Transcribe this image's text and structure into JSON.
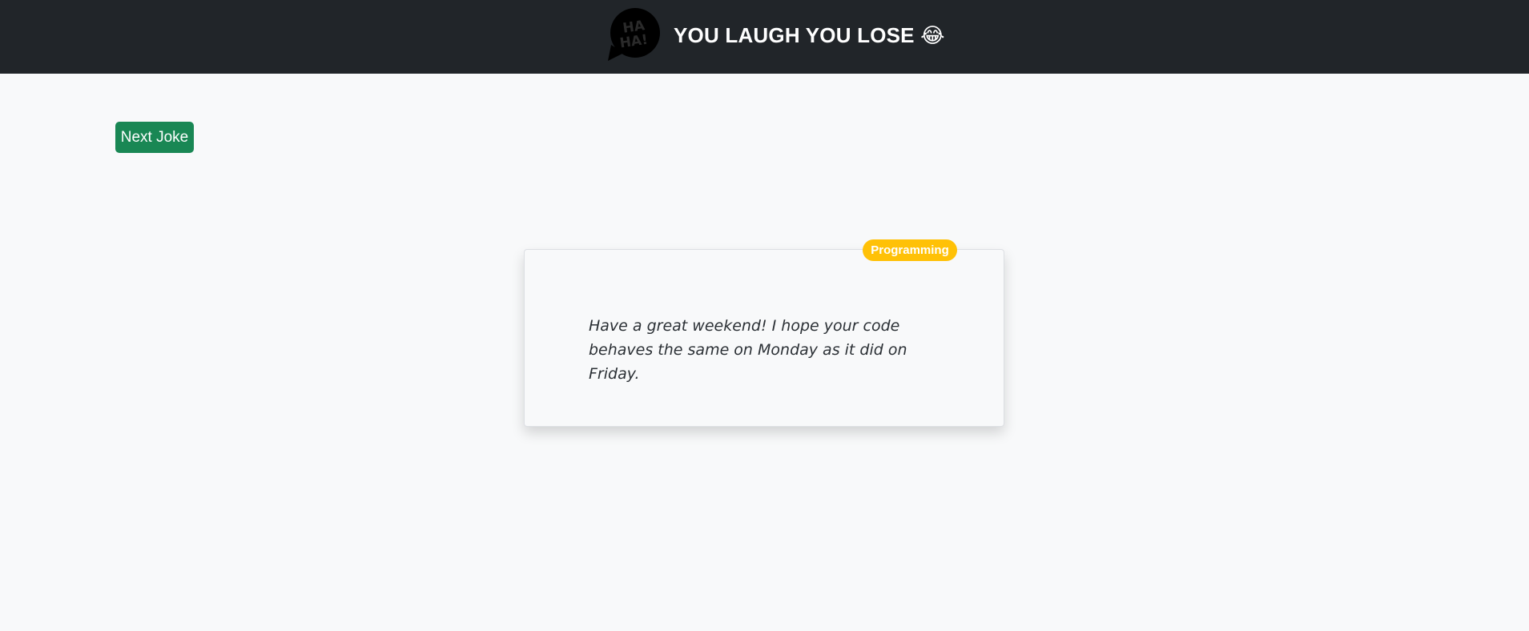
{
  "header": {
    "logo_text": "HA HA!",
    "title": "YOU LAUGH YOU LOSE 😂"
  },
  "actions": {
    "next_label": "Next Joke"
  },
  "joke": {
    "category": "Programming",
    "text": "Have a great weekend! I hope your code behaves the same on Monday as it did on Friday."
  },
  "colors": {
    "navbar_bg": "#212529",
    "page_bg": "#f8f9fa",
    "button_bg": "#198754",
    "badge_bg": "#ffc107"
  },
  "icons": {
    "logo": "haha-speech-bubble-icon"
  }
}
